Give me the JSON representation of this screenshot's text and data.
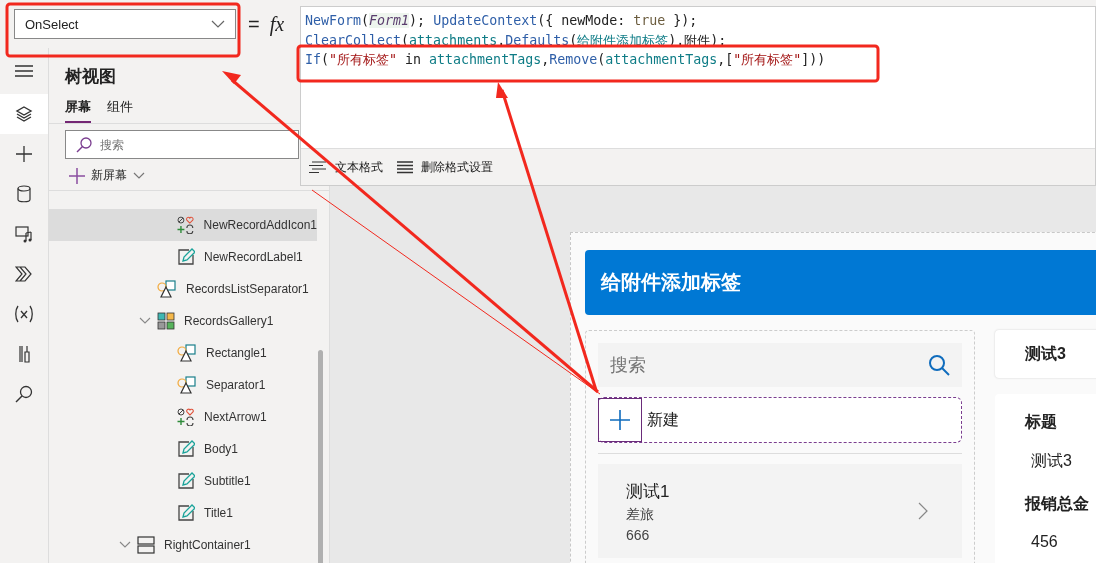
{
  "property_bar": {
    "property": "OnSelect",
    "equals": "=",
    "fx": "fx"
  },
  "formula": {
    "lines": [
      [
        {
          "kind": "func",
          "text": "NewForm"
        },
        {
          "kind": "plain",
          "text": "("
        },
        {
          "kind": "control",
          "text": "Form1"
        },
        {
          "kind": "plain",
          "text": "); "
        },
        {
          "kind": "func",
          "text": "UpdateContext"
        },
        {
          "kind": "plain",
          "text": "({ newMode: "
        },
        {
          "kind": "keyword",
          "text": "true"
        },
        {
          "kind": "plain",
          "text": " });"
        }
      ],
      [
        {
          "kind": "func",
          "text": "ClearCollect"
        },
        {
          "kind": "plain",
          "text": "("
        },
        {
          "kind": "ident",
          "text": "attachments"
        },
        {
          "kind": "plain",
          "text": "."
        },
        {
          "kind": "func",
          "text": "Defaults"
        },
        {
          "kind": "plain",
          "text": "("
        },
        {
          "kind": "ident",
          "text": "给附件添加标签"
        },
        {
          "kind": "plain",
          "text": ").附件);"
        }
      ],
      [
        {
          "kind": "func",
          "text": "If"
        },
        {
          "kind": "plain",
          "text": "("
        },
        {
          "kind": "string",
          "text": "\"所有标签\""
        },
        {
          "kind": "plain",
          "text": " in "
        },
        {
          "kind": "ident",
          "text": "attachmentTags"
        },
        {
          "kind": "plain",
          "text": ","
        },
        {
          "kind": "func",
          "text": "Remove"
        },
        {
          "kind": "plain",
          "text": "("
        },
        {
          "kind": "ident",
          "text": "attachmentTags"
        },
        {
          "kind": "plain",
          "text": ",["
        },
        {
          "kind": "string",
          "text": "\"所有标签\""
        },
        {
          "kind": "plain",
          "text": "]))"
        }
      ]
    ],
    "toolbar": [
      {
        "kind": "format",
        "label": "文本格式"
      },
      {
        "kind": "clear",
        "label": "删除格式设置"
      }
    ]
  },
  "rail": [
    {
      "kind": "menu",
      "selected": false
    },
    {
      "kind": "layers",
      "selected": true
    },
    {
      "kind": "insert",
      "selected": false
    },
    {
      "kind": "data",
      "selected": false
    },
    {
      "kind": "media",
      "selected": false
    },
    {
      "kind": "automate",
      "selected": false
    },
    {
      "kind": "variables",
      "selected": false
    },
    {
      "kind": "tools",
      "selected": false
    },
    {
      "kind": "search",
      "selected": false
    }
  ],
  "tree_view": {
    "title": "树视图",
    "tabs": [
      {
        "label": "屏幕",
        "selected": true
      },
      {
        "label": "组件",
        "selected": false
      }
    ],
    "search": {
      "placeholder": "搜索"
    },
    "new_screen": "新屏幕",
    "items": [
      {
        "children": [
          {
            "children": [
              {
                "name": "NewRecordAddIcon1",
                "kind": "icon",
                "selected": true
              },
              {
                "name": "NewRecordLabel1",
                "kind": "label",
                "selected": false
              }
            ]
          },
          {
            "name": "RecordsListSeparator1",
            "kind": "shape",
            "selected": false
          },
          {
            "name": "RecordsGallery1",
            "kind": "gallery",
            "selected": false,
            "expanded": true,
            "children": [
              {
                "name": "Rectangle1",
                "kind": "shape",
                "selected": false
              },
              {
                "name": "Separator1",
                "kind": "shape",
                "selected": false
              },
              {
                "name": "NextArrow1",
                "kind": "icon",
                "selected": false
              },
              {
                "name": "Body1",
                "kind": "label",
                "selected": false
              },
              {
                "name": "Subtitle1",
                "kind": "label",
                "selected": false
              },
              {
                "name": "Title1",
                "kind": "label",
                "selected": false
              }
            ]
          }
        ]
      },
      {
        "name": "RightContainer1",
        "kind": "container",
        "selected": false,
        "expanded": true
      }
    ]
  },
  "app": {
    "header": "给附件添加标签",
    "search": {
      "placeholder": "搜索"
    },
    "new_button": "新建",
    "gallery": [
      {
        "title": "测试1",
        "subtitle": "差旅",
        "body": "666"
      }
    ],
    "detail_title": "测试3",
    "fields": [
      {
        "label": "标题",
        "value": "测试3"
      },
      {
        "label": "报销总金",
        "value": "456"
      }
    ]
  }
}
